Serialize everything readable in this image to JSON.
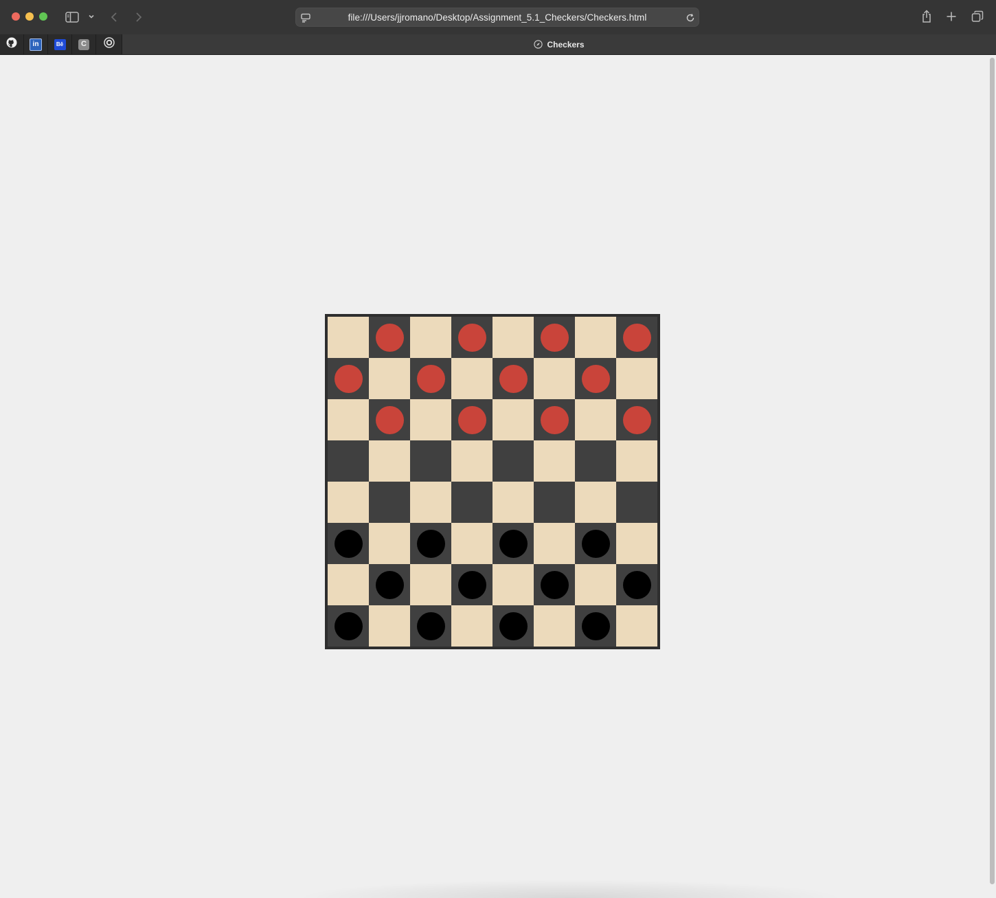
{
  "browser": {
    "url": "file:///Users/jjromano/Desktop/Assignment_5.1_Checkers/Checkers.html",
    "tab_title": "Checkers",
    "pinned_tabs": [
      {
        "name": "github-icon"
      },
      {
        "name": "linkedin-icon",
        "glyph": "in"
      },
      {
        "name": "behance-icon",
        "glyph": "Bē"
      },
      {
        "name": "c-app-icon",
        "glyph": "C"
      },
      {
        "name": "hub-icon"
      }
    ],
    "icons": [
      "sidebar-toggle-icon",
      "chevron-down-icon",
      "back-icon",
      "forward-icon",
      "page-menu-icon",
      "reload-icon",
      "share-icon",
      "new-tab-icon",
      "tab-overview-icon",
      "compass-icon"
    ]
  },
  "colors": {
    "light_square": "#ecdabb",
    "dark_square": "#404040",
    "red_piece": "#c9443a",
    "black_piece": "#000000",
    "page_background": "#efefef"
  },
  "board": {
    "rows": 8,
    "cols": 8,
    "pieces": [
      [
        "",
        "r",
        "",
        "r",
        "",
        "r",
        "",
        "r"
      ],
      [
        "r",
        "",
        "r",
        "",
        "r",
        "",
        "r",
        ""
      ],
      [
        "",
        "r",
        "",
        "r",
        "",
        "r",
        "",
        "r"
      ],
      [
        "",
        "",
        "",
        "",
        "",
        "",
        "",
        ""
      ],
      [
        "",
        "",
        "",
        "",
        "",
        "",
        "",
        ""
      ],
      [
        "b",
        "",
        "b",
        "",
        "b",
        "",
        "b",
        ""
      ],
      [
        "",
        "b",
        "",
        "b",
        "",
        "b",
        "",
        "b"
      ],
      [
        "b",
        "",
        "b",
        "",
        "b",
        "",
        "b",
        ""
      ]
    ]
  }
}
